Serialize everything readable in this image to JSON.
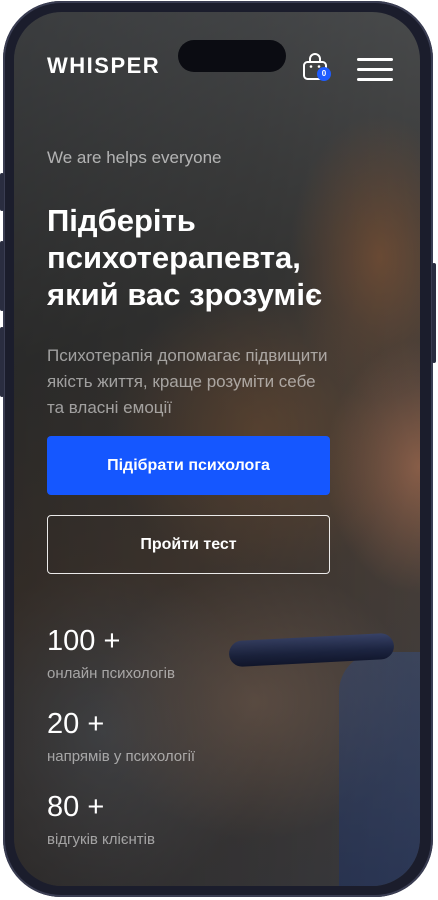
{
  "header": {
    "logo": "WHISPER",
    "cart_count": "0",
    "cart_icon": "shopping-bag-icon",
    "menu_icon": "hamburger-menu-icon"
  },
  "hero": {
    "tagline": "We are helps everyone",
    "headline_lines": [
      "Підберіть",
      "психотерапевта,",
      "який вас зрозуміє"
    ],
    "description_lines": [
      "Психотерапія допомагає підвищити",
      "якість життя, краще розуміти себе",
      "та власні емоції"
    ]
  },
  "buttons": {
    "primary": "Підібрати психолога",
    "secondary": "Пройти тест"
  },
  "stats": [
    {
      "value": "100 +",
      "label": "онлайн психологів"
    },
    {
      "value": "20 +",
      "label": "напрямів у психології"
    },
    {
      "value": "80 +",
      "label": "відгуків клієнтів"
    }
  ],
  "colors": {
    "accent": "#1557ff",
    "badge": "#1f5cff",
    "frame": "#1b1d2c",
    "text": "#ffffff"
  }
}
